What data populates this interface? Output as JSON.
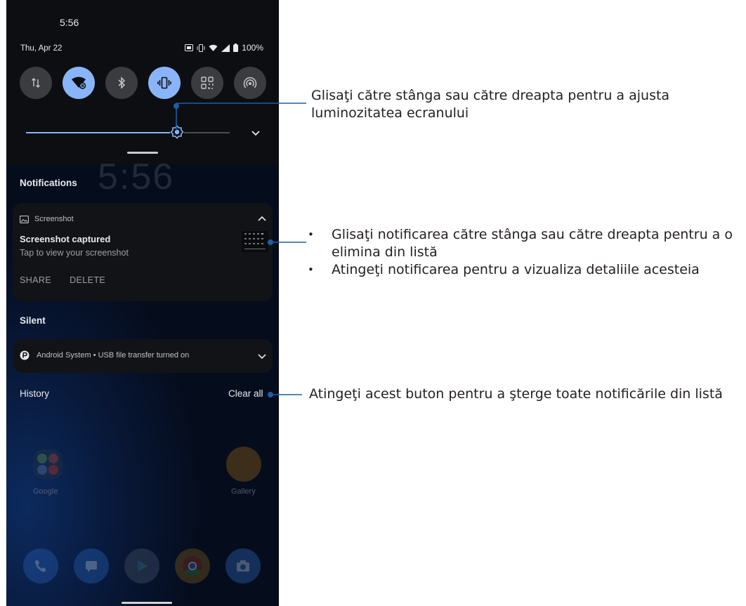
{
  "status_bar": {
    "time": "5:56",
    "date": "Thu, Apr 22",
    "battery": "100%"
  },
  "quick_tiles": [
    {
      "icon": "mobile-data-icon",
      "on": false
    },
    {
      "icon": "wifi-icon",
      "on": true
    },
    {
      "icon": "bluetooth-icon",
      "on": false
    },
    {
      "icon": "vibrate-icon",
      "on": true
    },
    {
      "icon": "qr-scanner-icon",
      "on": false
    },
    {
      "icon": "hotspot-icon",
      "on": false
    }
  ],
  "brightness": {
    "level": 0.74
  },
  "lockscreen_clock": "5:56",
  "notifications_header": "Notifications",
  "notification": {
    "app_name": "Screenshot",
    "title": "Screenshot captured",
    "text": "Tap to view your screenshot",
    "action_share": "SHARE",
    "action_delete": "DELETE"
  },
  "silent_header": "Silent",
  "silent_notification": {
    "text": "Android System • USB file transfer turned on"
  },
  "history_label": "History",
  "clear_all_label": "Clear all",
  "home_apps": {
    "google": "Google",
    "gallery": "Gallery"
  },
  "annotations": {
    "brightness": "Glisaţi către stânga sau către dreapta pentru a ajusta luminozitatea ecranului",
    "notification_bullets": [
      "Glisaţi notificarea către stânga sau către dreapta pentru a o elimina din listă",
      "Atingeţi notificarea pentru a vizualiza detaliile acesteia"
    ],
    "clear_all": "Atingeţi acest buton pentru a şterge toate notificările din listă"
  },
  "colors": {
    "accent": "#8ab4f8",
    "leader_line": "#1b5fa4",
    "panel": "#0d0e11"
  }
}
